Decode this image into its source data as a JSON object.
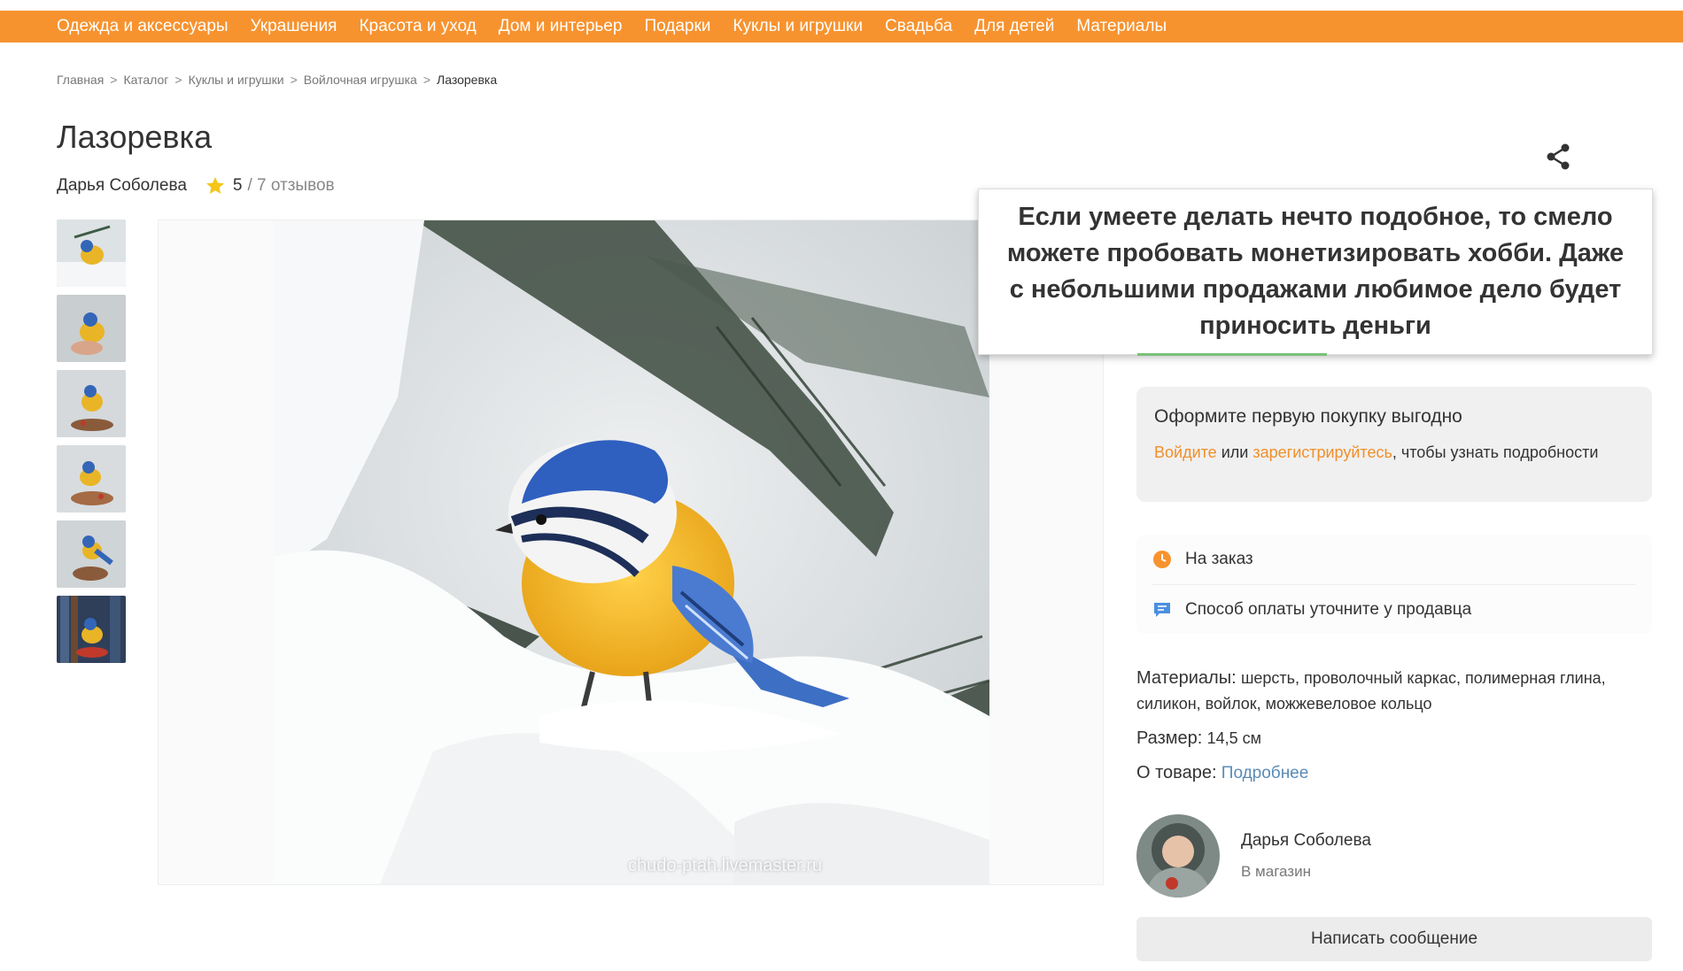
{
  "nav": {
    "items": [
      "Одежда и аксессуары",
      "Украшения",
      "Красота и уход",
      "Дом и интерьер",
      "Подарки",
      "Куклы и игрушки",
      "Свадьба",
      "Для детей",
      "Материалы"
    ],
    "color": "#f7932f"
  },
  "breadcrumb": {
    "items": [
      "Главная",
      "Каталог",
      "Куклы и игрушки",
      "Войлочная игрушка",
      "Лазоревка"
    ],
    "separator": ">"
  },
  "product": {
    "title": "Лазоревка",
    "seller": "Дарья Соболева",
    "rating": "5",
    "reviews": "/ 7 отзывов"
  },
  "photo": {
    "watermark": "chudo-ptah.livemaster.ru"
  },
  "overlay": {
    "text": "Если умеете делать нечто подобное, то смело можете пробовать монетизировать хобби. Даже с небольшими продажами любимое дело будет приносить деньги"
  },
  "promo": {
    "title": "Оформите первую покупку выгодно",
    "login": "Войдите",
    "or": "или",
    "register": "зарегистрируйтесь",
    "suffix": ", чтобы узнать подробности"
  },
  "info": {
    "order": "На заказ",
    "payment": "Способ оплаты уточните у продавца"
  },
  "specs": {
    "materials_label": "Материалы:",
    "materials_value": "шерсть, проволочный каркас, полимерная глина, силикон, войлок, можжевеловое кольцо",
    "size_label": "Размер:",
    "size_value": "14,5 см",
    "about_label": "О товаре:",
    "about_link": "Подробнее"
  },
  "seller_card": {
    "name": "Дарья Соболева",
    "store": "В магазин"
  },
  "actions": {
    "message": "Написать сообщение"
  },
  "icons": {
    "share": "share-icon",
    "star": "star-icon",
    "clock": "clock-icon",
    "chat": "chat-icon"
  },
  "colors": {
    "accent": "#f7932f",
    "link": "#5a8bb8",
    "star": "#f5c518"
  }
}
